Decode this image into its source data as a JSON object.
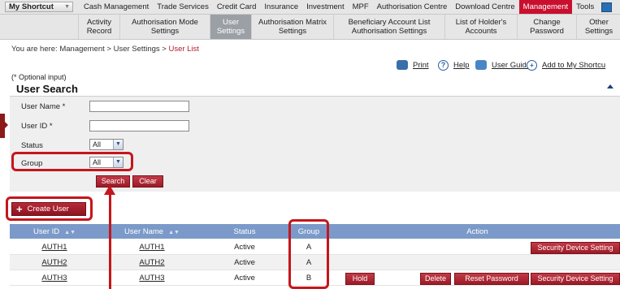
{
  "topnav": {
    "shortcut": "My Shortcut",
    "items": [
      "Cash Management",
      "Trade Services",
      "Credit Card",
      "Insurance",
      "Investment",
      "MPF",
      "Authorisation Centre",
      "Download Centre",
      "Management",
      "Tools"
    ]
  },
  "subnav": {
    "items": [
      {
        "l1": "Activity",
        "l2": "Record"
      },
      {
        "l1": "Authorisation Mode",
        "l2": "Settings"
      },
      {
        "l1": "User",
        "l2": "Settings"
      },
      {
        "l1": "Authorisation Matrix",
        "l2": "Settings"
      },
      {
        "l1": "Beneficiary Account List",
        "l2": "Authorisation Settings"
      },
      {
        "l1": "List of Holder's",
        "l2": "Accounts"
      },
      {
        "l1": "Change",
        "l2": "Password"
      },
      {
        "l1": "Other",
        "l2": "Settings"
      }
    ]
  },
  "breadcrumb": {
    "prefix": "You are here: Management > User Settings > ",
    "current": "User List"
  },
  "tools": {
    "print": "Print",
    "help": "Help",
    "guide": "User Guide",
    "shortcut": "Add to My Shortcu"
  },
  "optional_note": "(* Optional input)",
  "search": {
    "title": "User Search",
    "username_label": "User Name *",
    "userid_label": "User ID *",
    "status_label": "Status",
    "status_value": "All",
    "group_label": "Group",
    "group_value": "All",
    "search_btn": "Search",
    "clear_btn": "Clear"
  },
  "create_user": "Create User",
  "table": {
    "headers": {
      "userid": "User ID",
      "username": "User Name",
      "status": "Status",
      "group": "Group",
      "action": "Action"
    },
    "rows": [
      {
        "id": "AUTH1",
        "name": "AUTH1",
        "status": "Active",
        "group": "A"
      },
      {
        "id": "AUTH2",
        "name": "AUTH2",
        "status": "Active",
        "group": "A"
      },
      {
        "id": "AUTH3",
        "name": "AUTH3",
        "status": "Active",
        "group": "B"
      }
    ],
    "actions": {
      "hold": "Hold",
      "delete": "Delete",
      "reset": "Reset Password",
      "security": "Security Device Setting"
    }
  }
}
